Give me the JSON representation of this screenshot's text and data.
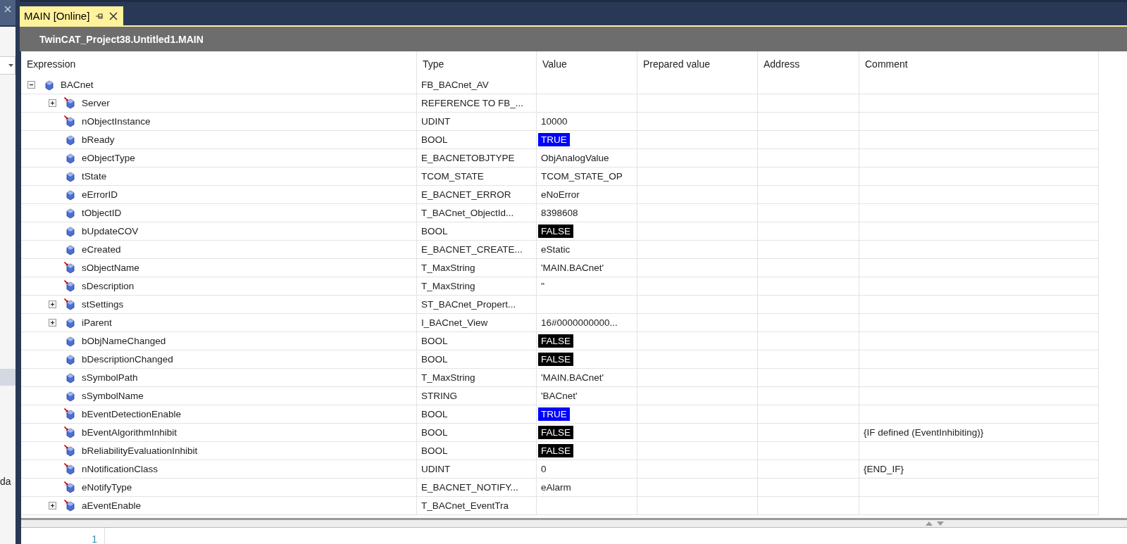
{
  "left_panel": {
    "text": "da"
  },
  "tab": {
    "title": "MAIN [Online]",
    "selected": true
  },
  "header": {
    "title": "TwinCAT_Project38.Untitled1.MAIN"
  },
  "table": {
    "columns": [
      "Expression",
      "Type",
      "Value",
      "Prepared value",
      "Address",
      "Comment"
    ],
    "rows": [
      {
        "name": "BACnet",
        "type": "FB_BACnet_AV",
        "kind": "plain",
        "expanded": true,
        "children": [
          {
            "name": "Server",
            "type": "REFERENCE TO FB_...",
            "kind": "marked",
            "expanded": false
          },
          {
            "name": "nObjectInstance",
            "type": "UDINT",
            "value": {
              "text": "10000",
              "kind": "text"
            },
            "kind": "marked"
          },
          {
            "name": "bReady",
            "type": "BOOL",
            "value": {
              "text": "TRUE",
              "kind": "true"
            },
            "kind": "plain"
          },
          {
            "name": "eObjectType",
            "type": "E_BACNETOBJTYPE",
            "value": {
              "text": "ObjAnalogValue",
              "kind": "text"
            },
            "kind": "plain"
          },
          {
            "name": "tState",
            "type": "TCOM_STATE",
            "value": {
              "text": "TCOM_STATE_OP",
              "kind": "text"
            },
            "kind": "plain"
          },
          {
            "name": "eErrorID",
            "type": "E_BACNET_ERROR",
            "value": {
              "text": "eNoError",
              "kind": "text"
            },
            "kind": "plain"
          },
          {
            "name": "tObjectID",
            "type": "T_BACnet_ObjectId...",
            "value": {
              "text": "8398608",
              "kind": "text"
            },
            "kind": "plain"
          },
          {
            "name": "bUpdateCOV",
            "type": "BOOL",
            "value": {
              "text": "FALSE",
              "kind": "false"
            },
            "kind": "plain"
          },
          {
            "name": "eCreated",
            "type": "E_BACNET_CREATE...",
            "value": {
              "text": "eStatic",
              "kind": "text"
            },
            "kind": "plain"
          },
          {
            "name": "sObjectName",
            "type": "T_MaxString",
            "value": {
              "text": "'MAIN.BACnet'",
              "kind": "text"
            },
            "kind": "marked"
          },
          {
            "name": "sDescription",
            "type": "T_MaxString",
            "value": {
              "text": "''",
              "kind": "text"
            },
            "kind": "marked"
          },
          {
            "name": "stSettings",
            "type": "ST_BACnet_Propert...",
            "kind": "marked",
            "expanded": false
          },
          {
            "name": "iParent",
            "type": "I_BACnet_View",
            "value": {
              "text": "16#0000000000...",
              "kind": "text"
            },
            "kind": "plain",
            "expanded": false
          },
          {
            "name": "bObjNameChanged",
            "type": "BOOL",
            "value": {
              "text": "FALSE",
              "kind": "false"
            },
            "kind": "plain"
          },
          {
            "name": "bDescriptionChanged",
            "type": "BOOL",
            "value": {
              "text": "FALSE",
              "kind": "false"
            },
            "kind": "plain"
          },
          {
            "name": "sSymbolPath",
            "type": "T_MaxString",
            "value": {
              "text": "'MAIN.BACnet'",
              "kind": "text"
            },
            "kind": "plain"
          },
          {
            "name": "sSymbolName",
            "type": "STRING",
            "value": {
              "text": "'BACnet'",
              "kind": "text"
            },
            "kind": "plain"
          },
          {
            "name": "bEventDetectionEnable",
            "type": "BOOL",
            "value": {
              "text": "TRUE",
              "kind": "true"
            },
            "kind": "marked"
          },
          {
            "name": "bEventAlgorithmInhibit",
            "type": "BOOL",
            "value": {
              "text": "FALSE",
              "kind": "false"
            },
            "comment": "{IF defined (EventInhibiting)}",
            "kind": "marked"
          },
          {
            "name": "bReliabilityEvaluationInhibit",
            "type": "BOOL",
            "value": {
              "text": "FALSE",
              "kind": "false"
            },
            "kind": "marked"
          },
          {
            "name": "nNotificationClass",
            "type": "UDINT",
            "value": {
              "text": "0",
              "kind": "text"
            },
            "comment": "{END_IF}",
            "kind": "marked"
          },
          {
            "name": "eNotifyType",
            "type": "E_BACNET_NOTIFY...",
            "value": {
              "text": "eAlarm",
              "kind": "text"
            },
            "kind": "marked"
          },
          {
            "name": "aEventEnable",
            "type": "T_BACnet_EventTra",
            "kind": "marked",
            "expanded": false
          }
        ]
      }
    ]
  },
  "editor": {
    "line_number": "1"
  }
}
